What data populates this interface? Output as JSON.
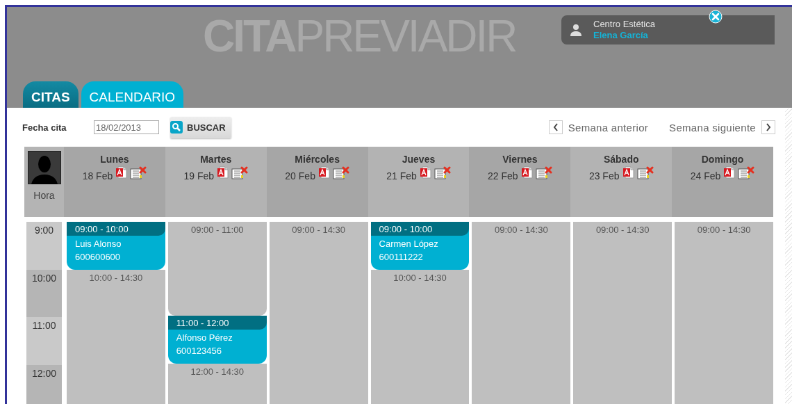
{
  "header": {
    "logo": "**CITA**PREVIADIR",
    "user": {
      "role": "Centro Estética",
      "name": "Elena García"
    }
  },
  "tabs": [
    {
      "label": "CITAS",
      "selected": true
    },
    {
      "label": "CALENDARIO",
      "selected": false
    }
  ],
  "toolbar": {
    "date_label": "Fecha cita",
    "date_value": "18/02/2013",
    "search_button": "BUSCAR",
    "prev_week": "Semana anterior",
    "next_week": "Semana siguiente"
  },
  "calendar": {
    "hour_header": "Hora",
    "hours": [
      "9:00",
      "10:00",
      "11:00",
      "12:00"
    ],
    "days": [
      {
        "name": "Lunes",
        "date": "18 Feb",
        "slots": [
          {
            "kind": "appointment",
            "time": "09:00 - 10:00",
            "client": "Luis Alonso",
            "phone": "600600600"
          },
          {
            "kind": "free",
            "time": "10:00 - 14:30"
          }
        ]
      },
      {
        "name": "Martes",
        "date": "19 Feb",
        "slots": [
          {
            "kind": "free",
            "time": "09:00 - 11:00"
          },
          {
            "kind": "appointment",
            "time": "11:00 - 12:00",
            "client": "Alfonso Pérez",
            "phone": "600123456"
          },
          {
            "kind": "free",
            "time": "12:00 - 14:30"
          }
        ]
      },
      {
        "name": "Miércoles",
        "date": "20 Feb",
        "slots": [
          {
            "kind": "free",
            "time": "09:00 - 14:30"
          }
        ]
      },
      {
        "name": "Jueves",
        "date": "21 Feb",
        "slots": [
          {
            "kind": "appointment",
            "time": "09:00 - 10:00",
            "client": "Carmen López",
            "phone": "600111222"
          },
          {
            "kind": "free",
            "time": "10:00 - 14:30"
          }
        ]
      },
      {
        "name": "Viernes",
        "date": "22 Feb",
        "slots": [
          {
            "kind": "free",
            "time": "09:00 - 14:30"
          }
        ]
      },
      {
        "name": "Sábado",
        "date": "23 Feb",
        "slots": [
          {
            "kind": "free",
            "time": "09:00 - 14:30"
          }
        ]
      },
      {
        "name": "Domingo",
        "date": "24 Feb",
        "slots": [
          {
            "kind": "free",
            "time": "09:00 - 14:30"
          }
        ]
      }
    ]
  }
}
